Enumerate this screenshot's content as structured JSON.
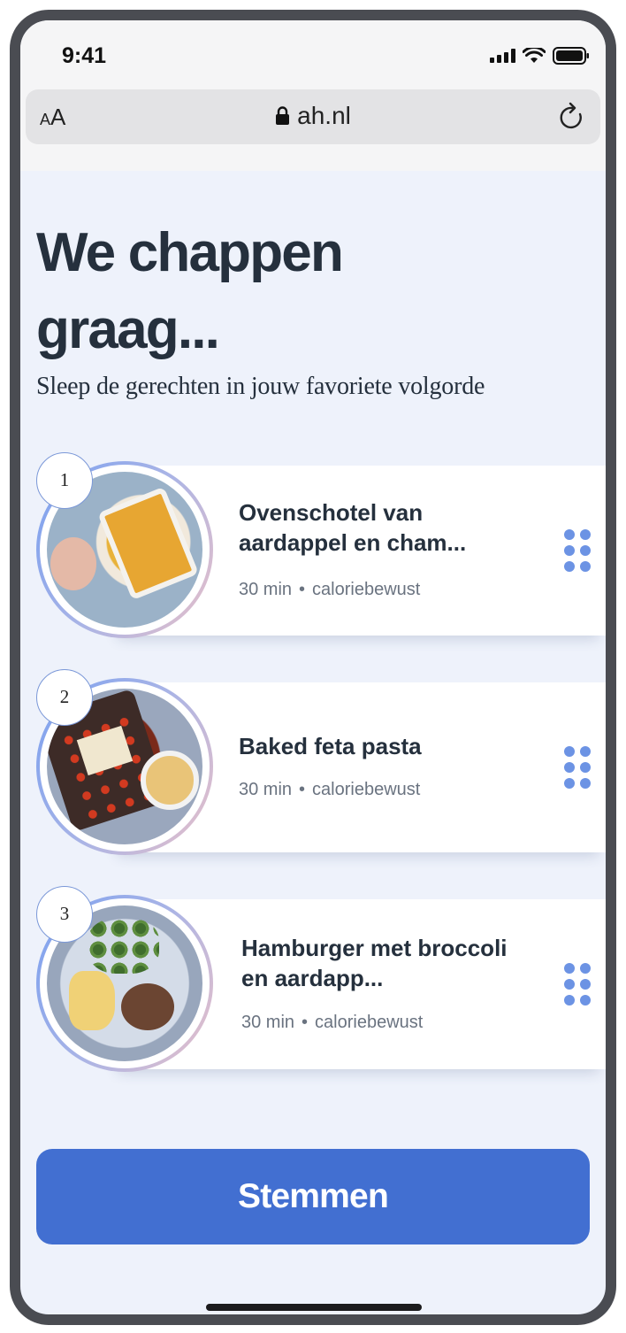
{
  "status_bar": {
    "time": "9:41"
  },
  "browser": {
    "text_size_small": "A",
    "text_size_large": "A",
    "url": "ah.nl"
  },
  "page": {
    "title": "We chappen graag...",
    "subtitle": "Sleep de gerechten in jouw favoriete volgorde"
  },
  "recipes": [
    {
      "rank": "1",
      "title": "Ovenschotel van aardappel en cham...",
      "time": "30 min",
      "tag": "caloriebewust"
    },
    {
      "rank": "2",
      "title": "Baked feta pasta",
      "time": "30 min",
      "tag": "caloriebewust"
    },
    {
      "rank": "3",
      "title": "Hamburger met broccoli en aardapp...",
      "time": "30 min",
      "tag": "caloriebewust"
    }
  ],
  "meta_separator": "•",
  "cta": {
    "label": "Stemmen"
  },
  "colors": {
    "background": "#eef2fb",
    "primary": "#426fd1",
    "heading": "#25303d",
    "drag_handle": "#6c93e4"
  },
  "icons": [
    "cellular-signal-icon",
    "wifi-icon",
    "battery-icon",
    "lock-icon",
    "reload-icon",
    "drag-handle-icon"
  ]
}
